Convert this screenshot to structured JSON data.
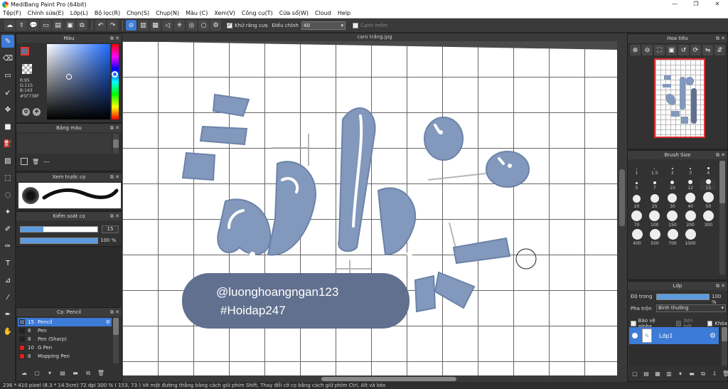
{
  "window": {
    "title": "MediBang Paint Pro (64bit)",
    "minimize": "—",
    "restore": "❐",
    "close": "✕"
  },
  "menu": [
    "Tệp(F)",
    "Chỉnh sửa(E)",
    "Lớp(L)",
    "Bộ lọc(R)",
    "Chọn(S)",
    "Chụp(N)",
    "Màu (C)",
    "Xem(V)",
    "Công cụ(T)",
    "Cửa sổ(W)",
    "Cloud",
    "Help"
  ],
  "toolbar": {
    "antialias_label": "Khử răng cưa",
    "adjust_label": "Điều chỉnh",
    "adjust_value": "40",
    "snap_label": "Cạnh mềm"
  },
  "document": {
    "tab_title": "caro trắng.jpg"
  },
  "canvas": {
    "watermark_line1": "@luonghoangngan123",
    "watermark_line2": "#Hoidap247"
  },
  "color_panel": {
    "title": "Màu",
    "r": "R:95",
    "g": "G:115",
    "b": "B:143",
    "hex": "#5F738F",
    "fg_color": "#5F738F",
    "bg_color": "#ffffff"
  },
  "palette_panel": {
    "title": "Bảng màu",
    "placeholder": "---"
  },
  "brush_preview_panel": {
    "title": "Xem trước cọ"
  },
  "brush_control_panel": {
    "title": "Kiểm soát cọ",
    "size_value": "15",
    "opacity_value": "100 %",
    "size_fraction": 0.3,
    "opacity_fraction": 1.0
  },
  "brush_list_panel": {
    "title": "Cọ: Pencil",
    "items": [
      {
        "size": "15",
        "name": "Pencil",
        "color": "#5F738F",
        "selected": true
      },
      {
        "size": "8",
        "name": "Pen",
        "color": "#222222",
        "selected": false
      },
      {
        "size": "8",
        "name": "Pen (Sharp)",
        "color": "#222222",
        "selected": false
      },
      {
        "size": "10",
        "name": "G Pen",
        "color": "#e02020",
        "selected": false
      },
      {
        "size": "8",
        "name": "Mapping Pen",
        "color": "#e02020",
        "selected": false
      }
    ]
  },
  "navigator_panel": {
    "title": "Hoa tiêu"
  },
  "brush_size_panel": {
    "title": "Brush Size",
    "rows": [
      [
        "1",
        "1.5",
        "2",
        "3",
        "4"
      ],
      [
        "5",
        "7",
        "10",
        "12",
        "15"
      ],
      [
        "20",
        "25",
        "30",
        "40",
        "50"
      ],
      [
        "70",
        "100",
        "150",
        "200",
        "300"
      ],
      [
        "400",
        "500",
        "700",
        "1000"
      ]
    ]
  },
  "layer_panel": {
    "title": "Lớp",
    "opacity_label": "Độ trong",
    "opacity_value": "100 %",
    "blend_label": "Pha trộn",
    "blend_value": "Bình thường",
    "protect_alpha": "Bảo vệ alpha",
    "clipping": "Xén bớt",
    "lock": "Khóa",
    "layer_name": "Lớp1"
  },
  "status": {
    "text": "236 * 410 pixel   (8.3 * 14.5cm)   72 dpi   300 %   ( 153, 73 )   Vẽ một đường thẳng bằng cách giữ phím Shift, Thay đổi cỡ cọ bằng cách giữ phím Ctrl, Alt và kéo"
  }
}
